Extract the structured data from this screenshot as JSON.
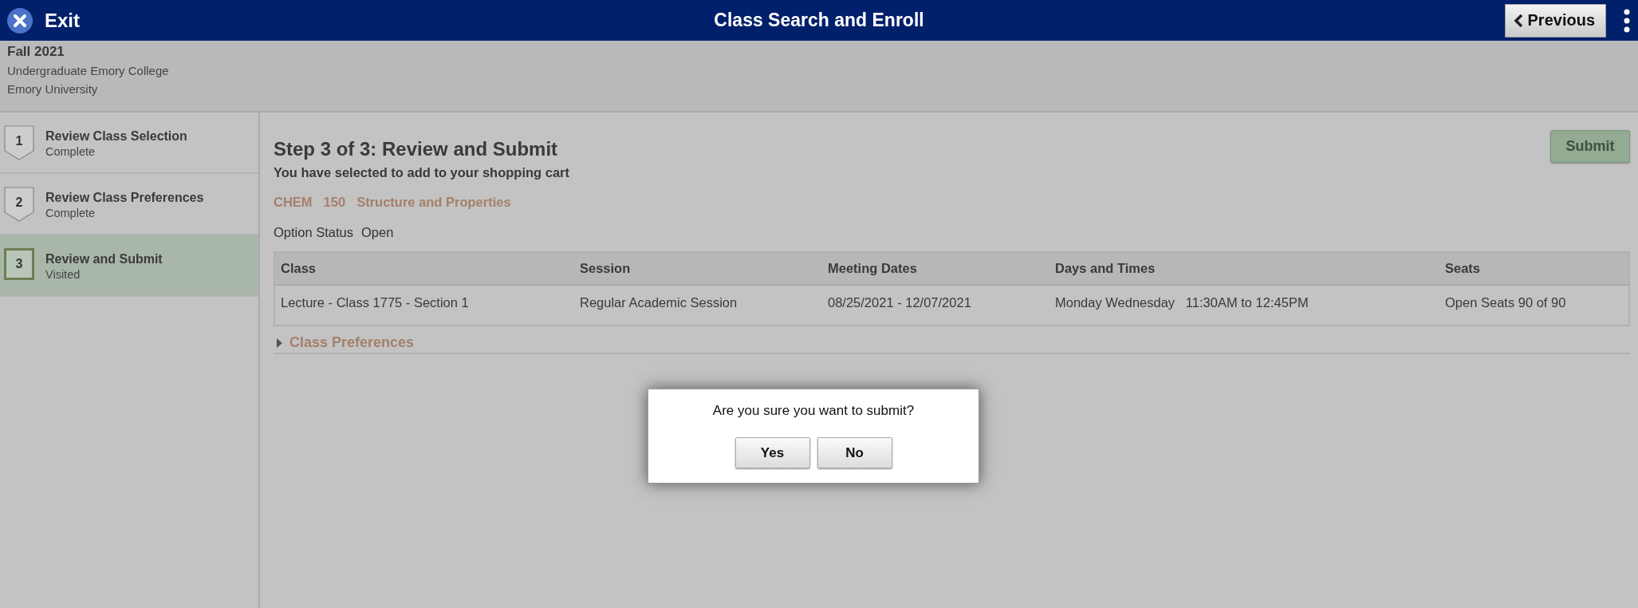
{
  "header": {
    "exit_label": "Exit",
    "title": "Class Search and Enroll",
    "previous_label": "Previous"
  },
  "term": {
    "name": "Fall 2021",
    "career": "Undergraduate Emory College",
    "institution": "Emory University"
  },
  "steps": [
    {
      "number": "1",
      "title": "Review Class Selection",
      "status": "Complete",
      "selected": false
    },
    {
      "number": "2",
      "title": "Review Class Preferences",
      "status": "Complete",
      "selected": false
    },
    {
      "number": "3",
      "title": "Review and Submit",
      "status": "Visited",
      "selected": true
    }
  ],
  "main": {
    "heading": "Step 3 of 3: Review and Submit",
    "submit_label": "Submit",
    "intro": "You have selected to add to your shopping cart",
    "course_subject": "CHEM",
    "course_number": "150",
    "course_title": "Structure and Properties",
    "option_status_label": "Option Status",
    "option_status": "Open"
  },
  "table": {
    "columns": [
      "Class",
      "Session",
      "Meeting Dates",
      "Days and Times",
      "Seats"
    ],
    "rows": [
      [
        "Lecture - Class 1775 - Section 1",
        "Regular Academic Session",
        "08/25/2021 - 12/07/2021",
        "Monday Wednesday   11:30AM to 12:45PM",
        "Open Seats 90 of 90"
      ]
    ]
  },
  "preferences": {
    "label": "Class Preferences",
    "expanded": false
  },
  "dialog": {
    "message": "Are you sure you want to submit?",
    "buttons": [
      "Yes",
      "No"
    ]
  }
}
